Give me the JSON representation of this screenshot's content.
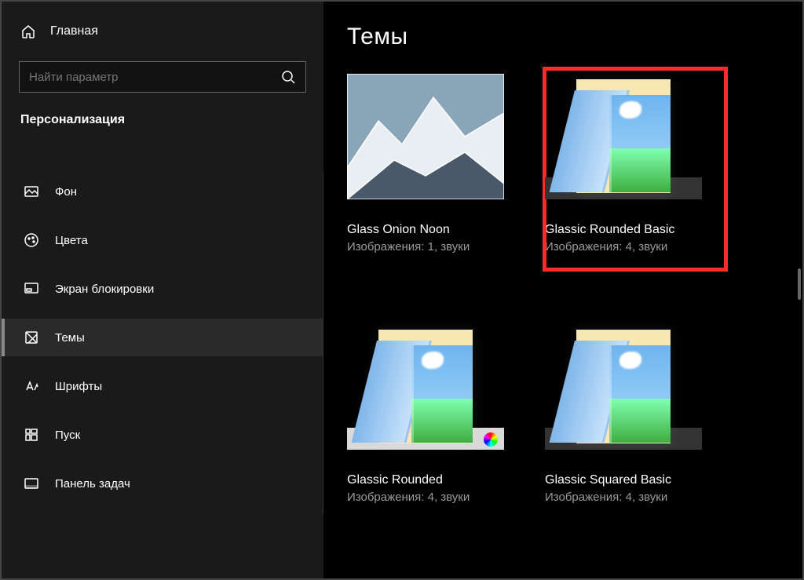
{
  "sidebar": {
    "home_label": "Главная",
    "search_placeholder": "Найти параметр",
    "section_title": "Персонализация",
    "items": [
      {
        "label": "Фон"
      },
      {
        "label": "Цвета"
      },
      {
        "label": "Экран блокировки"
      },
      {
        "label": "Темы"
      },
      {
        "label": "Шрифты"
      },
      {
        "label": "Пуск"
      },
      {
        "label": "Панель задач"
      }
    ]
  },
  "content": {
    "page_title": "Темы",
    "themes": [
      {
        "name": "Glass Onion Noon",
        "meta": "Изображения: 1, звуки",
        "kind": "mountain",
        "highlight": false,
        "taskbar": false,
        "colordot": false
      },
      {
        "name": "Glassic Rounded Basic",
        "meta": "Изображения: 4, звуки",
        "kind": "folder",
        "highlight": true,
        "taskbar": false,
        "colordot": false
      },
      {
        "name": "Glassic Rounded",
        "meta": "Изображения: 4, звуки",
        "kind": "folder",
        "highlight": false,
        "taskbar": true,
        "colordot": true
      },
      {
        "name": "Glassic Squared Basic",
        "meta": "Изображения: 4, звуки",
        "kind": "folder",
        "highlight": false,
        "taskbar": false,
        "colordot": false
      }
    ]
  }
}
